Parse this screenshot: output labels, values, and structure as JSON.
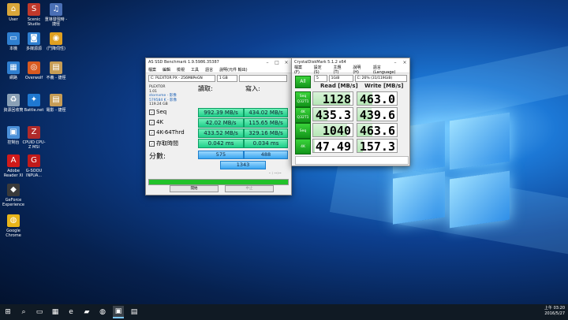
{
  "desktop": {
    "icons": [
      {
        "label": "User",
        "glyph": "⌂",
        "color": "#d8a63a"
      },
      {
        "label": "Scenic Studio",
        "glyph": "S",
        "color": "#c0392b"
      },
      {
        "label": "重導發現時 - 捷徑",
        "glyph": "♫",
        "color": "#4a6fb5"
      },
      {
        "label": "本機",
        "glyph": "▭",
        "color": "#2f7fd0"
      },
      {
        "label": "多媒源源",
        "glyph": "◙",
        "color": "#2f7fd0"
      },
      {
        "label": "(鬥降伺性)",
        "glyph": "◉",
        "color": "#e0a020"
      },
      {
        "label": "網路",
        "glyph": "▦",
        "color": "#2f7fd0"
      },
      {
        "label": "Overwolf",
        "glyph": "◎",
        "color": "#d85a20"
      },
      {
        "label": "不義 - 捷徑",
        "glyph": "▤",
        "color": "#c69c55"
      },
      {
        "label": "資源回收筒",
        "glyph": "♻",
        "color": "#8aa0b5"
      },
      {
        "label": "Battle.net",
        "glyph": "✦",
        "color": "#1f78d1"
      },
      {
        "label": "電影 - 捷徑",
        "glyph": "▤",
        "color": "#c69c55"
      },
      {
        "label": "控制台",
        "glyph": "▣",
        "color": "#4a90d9"
      },
      {
        "label": "CPUID CPU-Z MSI",
        "glyph": "Z",
        "color": "#b02a2a"
      },
      {
        "label": "Adobe Reader XI",
        "glyph": "A",
        "color": "#d11a1a"
      },
      {
        "label": "G-SOOU INPUA...",
        "glyph": "G",
        "color": "#c01a1a"
      },
      {
        "label": "GeForce Experience",
        "glyph": "◆",
        "color": "#3a3a3a"
      },
      {
        "label": "Google Chrome",
        "glyph": "◍",
        "color": "#e8b51a"
      }
    ]
  },
  "asssd": {
    "title": "AS SSD Benchmark 1.9.5986.35387",
    "menu": [
      "檔案",
      "編輯",
      "檢視",
      "工具",
      "語言",
      "說明(元件 輸出)"
    ],
    "drive_select": "C: PLEXTOR PX - 256M8PeGN",
    "size_select": "1 GB",
    "info": [
      "PLEXTOR",
      "1.01",
      "stornvme - 影像",
      "579584 K - 影像",
      "119.24 GB"
    ],
    "read_header": "讀取:",
    "write_header": "寫入:",
    "rows": [
      {
        "label": "Seq",
        "read": "992.39 MB/s",
        "write": "434.02 MB/s"
      },
      {
        "label": "4K",
        "read": "42.02 MB/s",
        "write": "115.65 MB/s"
      },
      {
        "label": "4K-64Thrd",
        "read": "433.52 MB/s",
        "write": "329.16 MB/s"
      },
      {
        "label": "存取時間",
        "read": "0.042 ms",
        "write": "0.034 ms"
      }
    ],
    "score_label": "分數:",
    "score_read": "575",
    "score_write": "488",
    "score_total": "1343",
    "progress_pct": 100,
    "start_button": "開始",
    "stop_button": "中止",
    "status": "- : --:--"
  },
  "cdm": {
    "title": "CrystalDiskMark 5.1.2 x64",
    "menu": [
      "檔案(F)",
      "設定(S)",
      "主題(T)",
      "說明(H)",
      "語言(Language)"
    ],
    "runs": "5",
    "size": "1GiB",
    "drive": "C: 26% (31/119GiB)",
    "all_button": "All",
    "read_header": "Read [MB/s]",
    "write_header": "Write [MB/s]",
    "rows": [
      {
        "label": "Seq\nQ32T1",
        "read": "1128",
        "write": "463.0"
      },
      {
        "label": "4K\nQ32T1",
        "read": "435.3",
        "write": "439.6"
      },
      {
        "label": "Seq",
        "read": "1040",
        "write": "463.6"
      },
      {
        "label": "4K",
        "read": "47.49",
        "write": "157.3"
      }
    ]
  },
  "taskbar": {
    "items": [
      {
        "name": "start",
        "glyph": "⊞"
      },
      {
        "name": "search",
        "glyph": "⌕"
      },
      {
        "name": "task-view",
        "glyph": "▭"
      },
      {
        "name": "calculator",
        "glyph": "▦"
      },
      {
        "name": "edge",
        "glyph": "e"
      },
      {
        "name": "explorer",
        "glyph": "▰"
      },
      {
        "name": "chrome",
        "glyph": "◍"
      },
      {
        "name": "as-ssd",
        "glyph": "▣"
      },
      {
        "name": "crystaldiskmark",
        "glyph": "▤"
      }
    ],
    "time": "上午 03:20",
    "date": "2016/5/27"
  }
}
